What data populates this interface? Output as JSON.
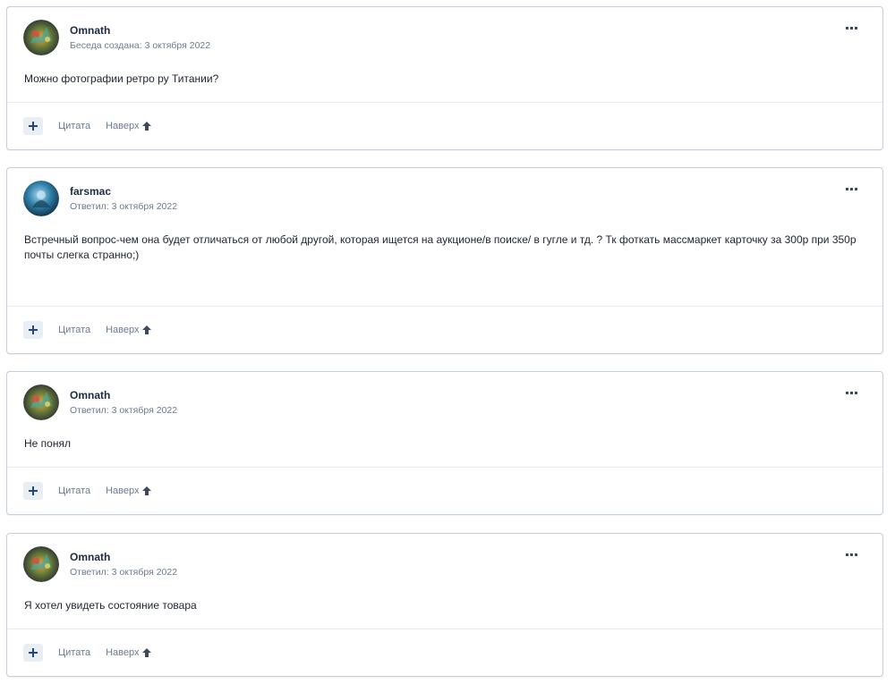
{
  "posts": [
    {
      "author": "Omnath",
      "date": "Беседа создана: 3 октября 2022",
      "text": "Можно фотографии ретро ру Титании?",
      "avatar": "omnath-avatar",
      "quote_label": "Цитата",
      "up_label": "Наверх"
    },
    {
      "author": "farsmac",
      "date": "Ответил: 3 октября 2022",
      "text": "Встречный вопрос-чем она будет отличаться от любой другой, которая ищется на аукционе/в поиске/ в гугле и тд. ? Тк фоткать массмаркет карточку за 300р при 350р почты слегка странно;)",
      "avatar": "farsmac-avatar",
      "quote_label": "Цитата",
      "up_label": "Наверх"
    },
    {
      "author": "Omnath",
      "date": "Ответил: 3 октября 2022",
      "text": "Не понял",
      "avatar": "omnath-avatar",
      "quote_label": "Цитата",
      "up_label": "Наверх"
    },
    {
      "author": "Omnath",
      "date": "Ответил: 3 октября 2022",
      "text": "Я хотел увидеть состояние товара",
      "avatar": "omnath-avatar",
      "quote_label": "Цитата",
      "up_label": "Наверх"
    }
  ],
  "icons": {
    "menu": "more-dots-icon",
    "plus": "plus-icon",
    "up": "arrow-up-icon"
  },
  "colors": {
    "border": "#c3cfdf",
    "accent": "#2a4a75",
    "muted": "#6b7a8e"
  }
}
